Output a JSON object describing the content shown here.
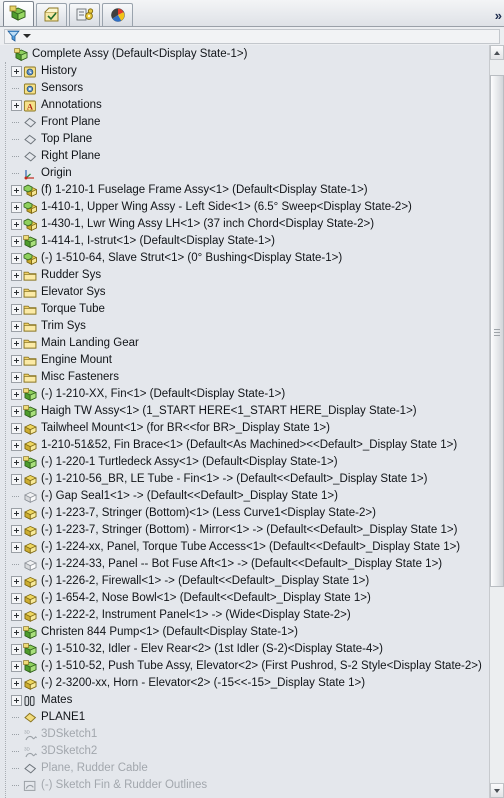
{
  "panel": {
    "title": "FeatureManager Design Tree",
    "tabs": [
      {
        "name": "feature-manager-tab",
        "icon": "assembly-tree-icon",
        "label": "FeatureManager Design Tree",
        "active": true
      },
      {
        "name": "property-manager-tab",
        "icon": "property-manager-icon",
        "label": "PropertyManager",
        "active": false
      },
      {
        "name": "configuration-manager-tab",
        "icon": "configuration-manager-icon",
        "label": "ConfigurationManager",
        "active": false
      },
      {
        "name": "display-manager-tab",
        "icon": "display-manager-icon",
        "label": "DisplayManager",
        "active": false
      }
    ],
    "expand_chevron": "»",
    "filter": {
      "icon": "filter-funnel-icon",
      "value": "",
      "placeholder": ""
    }
  },
  "scrollbar": {
    "up_arrow": "▲",
    "down_arrow": "▼",
    "thumb_top_pct": 2,
    "thumb_height_pct": 68
  },
  "tree": [
    {
      "indent": 0,
      "toggle": "none",
      "icon": "assembly-icon",
      "label": "Complete Assy  (Default<Display State-1>)"
    },
    {
      "indent": 1,
      "toggle": "plus",
      "icon": "history-icon",
      "label": "History"
    },
    {
      "indent": 1,
      "toggle": "leaf",
      "icon": "sensors-icon",
      "label": "Sensors"
    },
    {
      "indent": 1,
      "toggle": "plus",
      "icon": "annotations-icon",
      "label": "Annotations"
    },
    {
      "indent": 1,
      "toggle": "leaf",
      "icon": "plane-icon",
      "label": "Front Plane"
    },
    {
      "indent": 1,
      "toggle": "leaf",
      "icon": "plane-icon",
      "label": "Top Plane"
    },
    {
      "indent": 1,
      "toggle": "leaf",
      "icon": "plane-icon",
      "label": "Right Plane"
    },
    {
      "indent": 1,
      "toggle": "leaf",
      "icon": "origin-icon",
      "label": "Origin"
    },
    {
      "indent": 1,
      "toggle": "plus",
      "icon": "subassembly-icon",
      "label": "(f) 1-210-1 Fuselage Frame Assy<1> (Default<Display State-1>)"
    },
    {
      "indent": 1,
      "toggle": "plus",
      "icon": "subassembly-icon",
      "label": "1-410-1, Upper Wing Assy - Left Side<1> (6.5° Sweep<Display State-2>)"
    },
    {
      "indent": 1,
      "toggle": "plus",
      "icon": "subassembly-icon",
      "label": "1-430-1, Lwr Wing Assy LH<1> (37 inch Chord<Display State-2>)"
    },
    {
      "indent": 1,
      "toggle": "plus",
      "icon": "assembly-icon",
      "label": "1-414-1, I-strut<1> (Default<Display State-1>)"
    },
    {
      "indent": 1,
      "toggle": "plus",
      "icon": "subassembly-icon",
      "label": "(-) 1-510-64, Slave Strut<1> (0° Bushing<Display State-1>)"
    },
    {
      "indent": 1,
      "toggle": "plus",
      "icon": "folder-icon",
      "label": "Rudder Sys"
    },
    {
      "indent": 1,
      "toggle": "plus",
      "icon": "folder-icon",
      "label": "Elevator Sys"
    },
    {
      "indent": 1,
      "toggle": "plus",
      "icon": "folder-icon",
      "label": "Torque Tube"
    },
    {
      "indent": 1,
      "toggle": "plus",
      "icon": "folder-icon",
      "label": "Trim Sys"
    },
    {
      "indent": 1,
      "toggle": "plus",
      "icon": "folder-icon",
      "label": "Main Landing Gear"
    },
    {
      "indent": 1,
      "toggle": "plus",
      "icon": "folder-icon",
      "label": "Engine Mount"
    },
    {
      "indent": 1,
      "toggle": "plus",
      "icon": "folder-icon",
      "label": "Misc Fasteners"
    },
    {
      "indent": 1,
      "toggle": "plus",
      "icon": "assembly-icon",
      "label": "(-) 1-210-XX, Fin<1> (Default<Display State-1>)"
    },
    {
      "indent": 1,
      "toggle": "plus",
      "icon": "assembly-icon",
      "label": "Haigh TW Assy<1> (1_START HERE<1_START HERE_Display State-1>)"
    },
    {
      "indent": 1,
      "toggle": "plus",
      "icon": "part-icon",
      "label": "Tailwheel Mount<1> (for BR<<for BR>_Display State 1>)"
    },
    {
      "indent": 1,
      "toggle": "plus",
      "icon": "part-icon",
      "label": "1-210-51&52, Fin Brace<1> (Default<As Machined><<Default>_Display State 1>)"
    },
    {
      "indent": 1,
      "toggle": "plus",
      "icon": "assembly-icon",
      "label": "(-) 1-220-1 Turtledeck Assy<1> (Default<Display State-1>)"
    },
    {
      "indent": 1,
      "toggle": "plus",
      "icon": "part-icon",
      "label": "(-) 1-210-56_BR, LE Tube - Fin<1> -> (Default<<Default>_Display State 1>)"
    },
    {
      "indent": 1,
      "toggle": "leaf",
      "icon": "part-suppressed-icon",
      "label": "(-) Gap Seal1<1> -> (Default<<Default>_Display State 1>)"
    },
    {
      "indent": 1,
      "toggle": "plus",
      "icon": "part-icon",
      "label": "(-) 1-223-7, Stringer (Bottom)<1> (Less Curve1<Display State-2>)"
    },
    {
      "indent": 1,
      "toggle": "plus",
      "icon": "part-icon",
      "label": "(-) 1-223-7, Stringer (Bottom) - Mirror<1> -> (Default<<Default>_Display State 1>)"
    },
    {
      "indent": 1,
      "toggle": "plus",
      "icon": "part-icon",
      "label": "(-) 1-224-xx, Panel, Torque Tube Access<1> (Default<<Default>_Display State 1>)"
    },
    {
      "indent": 1,
      "toggle": "leaf",
      "icon": "part-suppressed-icon",
      "label": "(-) 1-224-33, Panel -- Bot Fuse Aft<1> -> (Default<<Default>_Display State 1>)"
    },
    {
      "indent": 1,
      "toggle": "plus",
      "icon": "part-icon",
      "label": "(-) 1-226-2, Firewall<1> -> (Default<<Default>_Display State 1>)"
    },
    {
      "indent": 1,
      "toggle": "plus",
      "icon": "part-icon",
      "label": "(-) 1-654-2, Nose Bowl<1> (Default<<Default>_Display State 1>)"
    },
    {
      "indent": 1,
      "toggle": "plus",
      "icon": "part-icon",
      "label": "(-) 1-222-2, Instrument Panel<1> -> (Wide<Display State-2>)"
    },
    {
      "indent": 1,
      "toggle": "plus",
      "icon": "assembly-icon",
      "label": "Christen 844 Pump<1> (Default<Display State-1>)"
    },
    {
      "indent": 1,
      "toggle": "plus",
      "icon": "assembly-icon",
      "label": "(-) 1-510-32, Idler - Elev Rear<2> (1st Idler (S-2)<Display State-4>)"
    },
    {
      "indent": 1,
      "toggle": "plus",
      "icon": "assembly-icon",
      "label": "(-) 1-510-52, Push Tube Assy, Elevator<2> (First Pushrod, S-2 Style<Display State-2>)"
    },
    {
      "indent": 1,
      "toggle": "plus",
      "icon": "part-icon",
      "label": "(-) 2-3200-xx, Horn - Elevator<2> (-15<<-15>_Display State 1>)"
    },
    {
      "indent": 1,
      "toggle": "plus",
      "icon": "mates-icon",
      "label": "Mates"
    },
    {
      "indent": 1,
      "toggle": "leaf",
      "icon": "plane-yellow-icon",
      "label": "PLANE1"
    },
    {
      "indent": 1,
      "toggle": "leaf",
      "icon": "sketch3d-icon",
      "label": "3DSketch1",
      "dim": true
    },
    {
      "indent": 1,
      "toggle": "leaf",
      "icon": "sketch3d-icon",
      "label": "3DSketch2",
      "dim": true
    },
    {
      "indent": 1,
      "toggle": "leaf",
      "icon": "plane-icon",
      "label": "Plane, Rudder Cable",
      "dim": true
    },
    {
      "indent": 1,
      "toggle": "leaf",
      "icon": "sketch-icon",
      "label": "(-) Sketch Fin & Rudder Outlines",
      "dim": true
    }
  ]
}
